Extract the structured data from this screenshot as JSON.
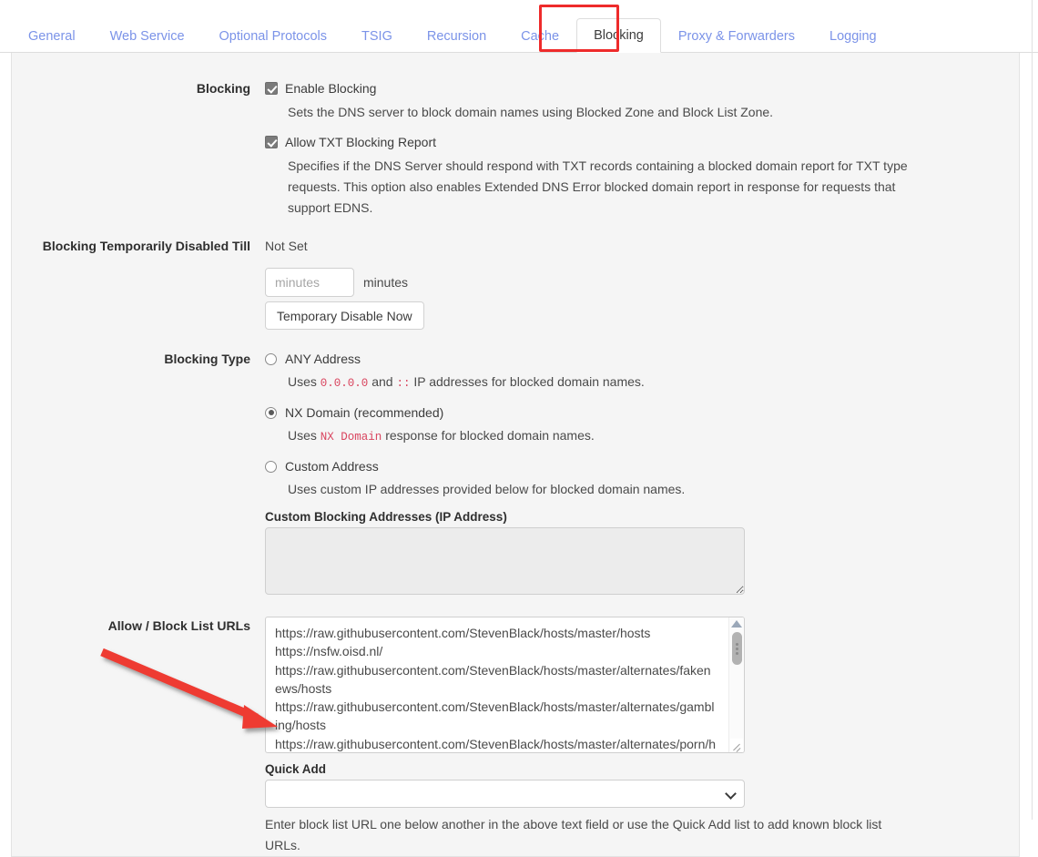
{
  "tabs": [
    {
      "label": "General",
      "active": false
    },
    {
      "label": "Web Service",
      "active": false
    },
    {
      "label": "Optional Protocols",
      "active": false
    },
    {
      "label": "TSIG",
      "active": false
    },
    {
      "label": "Recursion",
      "active": false
    },
    {
      "label": "Cache",
      "active": false
    },
    {
      "label": "Blocking",
      "active": true
    },
    {
      "label": "Proxy & Forwarders",
      "active": false
    },
    {
      "label": "Logging",
      "active": false
    }
  ],
  "blocking": {
    "label": "Blocking",
    "enable_blocking": {
      "label": "Enable Blocking",
      "checked": true,
      "description": "Sets the DNS server to block domain names using Blocked Zone and Block List Zone."
    },
    "allow_txt_report": {
      "label": "Allow TXT Blocking Report",
      "checked": true,
      "description": "Specifies if the DNS Server should respond with TXT records containing a blocked domain report for TXT type requests. This option also enables Extended DNS Error blocked domain report in response for requests that support EDNS."
    }
  },
  "temporarily_disabled": {
    "label": "Blocking Temporarily Disabled Till",
    "status": "Not Set",
    "minutes_input": {
      "value": "",
      "placeholder": "minutes"
    },
    "minutes_suffix": "minutes",
    "disable_button": "Temporary Disable Now"
  },
  "blocking_type": {
    "label": "Blocking Type",
    "options": [
      {
        "label": "ANY Address",
        "selected": false,
        "desc_pre": "Uses ",
        "code1": "0.0.0.0",
        "desc_mid": " and ",
        "code2": "::",
        "desc_post": " IP addresses for blocked domain names."
      },
      {
        "label": "NX Domain (recommended)",
        "selected": true,
        "desc_pre": "Uses ",
        "code1": "NX Domain",
        "desc_post": " response for blocked domain names."
      },
      {
        "label": "Custom Address",
        "selected": false,
        "desc_full": "Uses custom IP addresses provided below for blocked domain names."
      }
    ],
    "custom_addresses_label": "Custom Blocking Addresses (IP Address)",
    "custom_addresses_value": "",
    "custom_addresses_disabled": true
  },
  "block_list": {
    "label": "Allow / Block List URLs",
    "urls_text": "https://raw.githubusercontent.com/StevenBlack/hosts/master/hosts\nhttps://nsfw.oisd.nl/\nhttps://raw.githubusercontent.com/StevenBlack/hosts/master/alternates/fakenews/hosts\nhttps://raw.githubusercontent.com/StevenBlack/hosts/master/alternates/gambling/hosts\nhttps://raw.githubusercontent.com/StevenBlack/hosts/master/alternates/porn/h",
    "quick_add_label": "Quick Add",
    "quick_add_value": "",
    "quick_add_options": [
      ""
    ],
    "help_text": "Enter block list URL one below another in the above text field or use the Quick Add list to add known block list URLs."
  },
  "annotations": {
    "highlight_color": "#ee2b2b",
    "arrow_color": "#ee3b33",
    "arrow_target": "quick-add-dropdown"
  }
}
